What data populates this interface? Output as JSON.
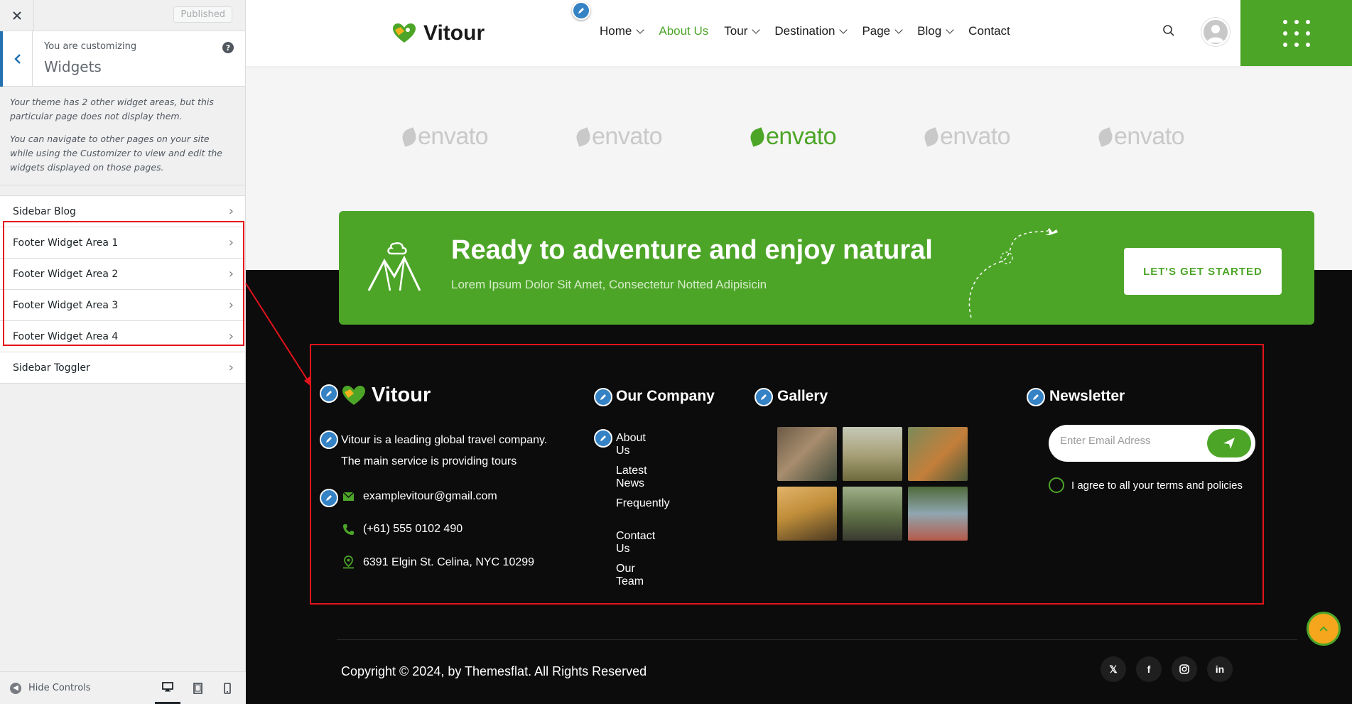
{
  "customizer": {
    "published_label": "Published",
    "customizing_label": "You are customizing",
    "section_title": "Widgets",
    "help_glyph": "?",
    "description_1": "Your theme has 2 other widget areas, but this particular page does not display them.",
    "description_2": "You can navigate to other pages on your site while using the Customizer to view and edit the widgets displayed on those pages.",
    "sections": [
      {
        "label": "Sidebar Blog"
      },
      {
        "label": "Footer Widget Area 1"
      },
      {
        "label": "Footer Widget Area 2"
      },
      {
        "label": "Footer Widget Area 3"
      },
      {
        "label": "Footer Widget Area 4"
      },
      {
        "label": "Sidebar Toggler"
      }
    ],
    "hide_controls_label": "Hide Controls",
    "highlight_color": "#e3131b",
    "accent_color": "#2271b1"
  },
  "site": {
    "brand": "Vitour",
    "brand_color": "#4da528",
    "nav": [
      {
        "label": "Home",
        "has_dropdown": true
      },
      {
        "label": "About Us",
        "active": true
      },
      {
        "label": "Tour",
        "has_dropdown": true
      },
      {
        "label": "Destination",
        "has_dropdown": true
      },
      {
        "label": "Page",
        "has_dropdown": true
      },
      {
        "label": "Blog",
        "has_dropdown": true
      },
      {
        "label": "Contact"
      }
    ],
    "partners": [
      "envato",
      "envato",
      "envato",
      "envato",
      "envato"
    ],
    "cta": {
      "title": "Ready to adventure and enjoy natural",
      "subtitle": "Lorem Ipsum Dolor Sit Amet, Consectetur Notted Adipisicin",
      "button": "LET'S GET STARTED"
    },
    "footer": {
      "brand": "Vitour",
      "about_line_1": "Vitour is a leading global travel company.",
      "about_line_2": "The main service is providing tours",
      "email": "examplevitour@gmail.com",
      "phone": "(+61) 555 0102 490",
      "address": "6391 Elgin St. Celina, NYC 10299",
      "company_title": "Our Company",
      "company_links": [
        "About Us",
        "Latest News",
        "Frequently",
        "Contact Us",
        "Our Team"
      ],
      "gallery_title": "Gallery",
      "newsletter_title": "Newsletter",
      "newsletter_placeholder": "Enter Email Adress",
      "agree_text": "I agree to all your terms and policies"
    },
    "copyright": "Copyright © 2024, by Themesflat. All Rights Reserved",
    "socials": [
      "x-icon",
      "facebook-icon",
      "instagram-icon",
      "linkedin-icon"
    ]
  }
}
